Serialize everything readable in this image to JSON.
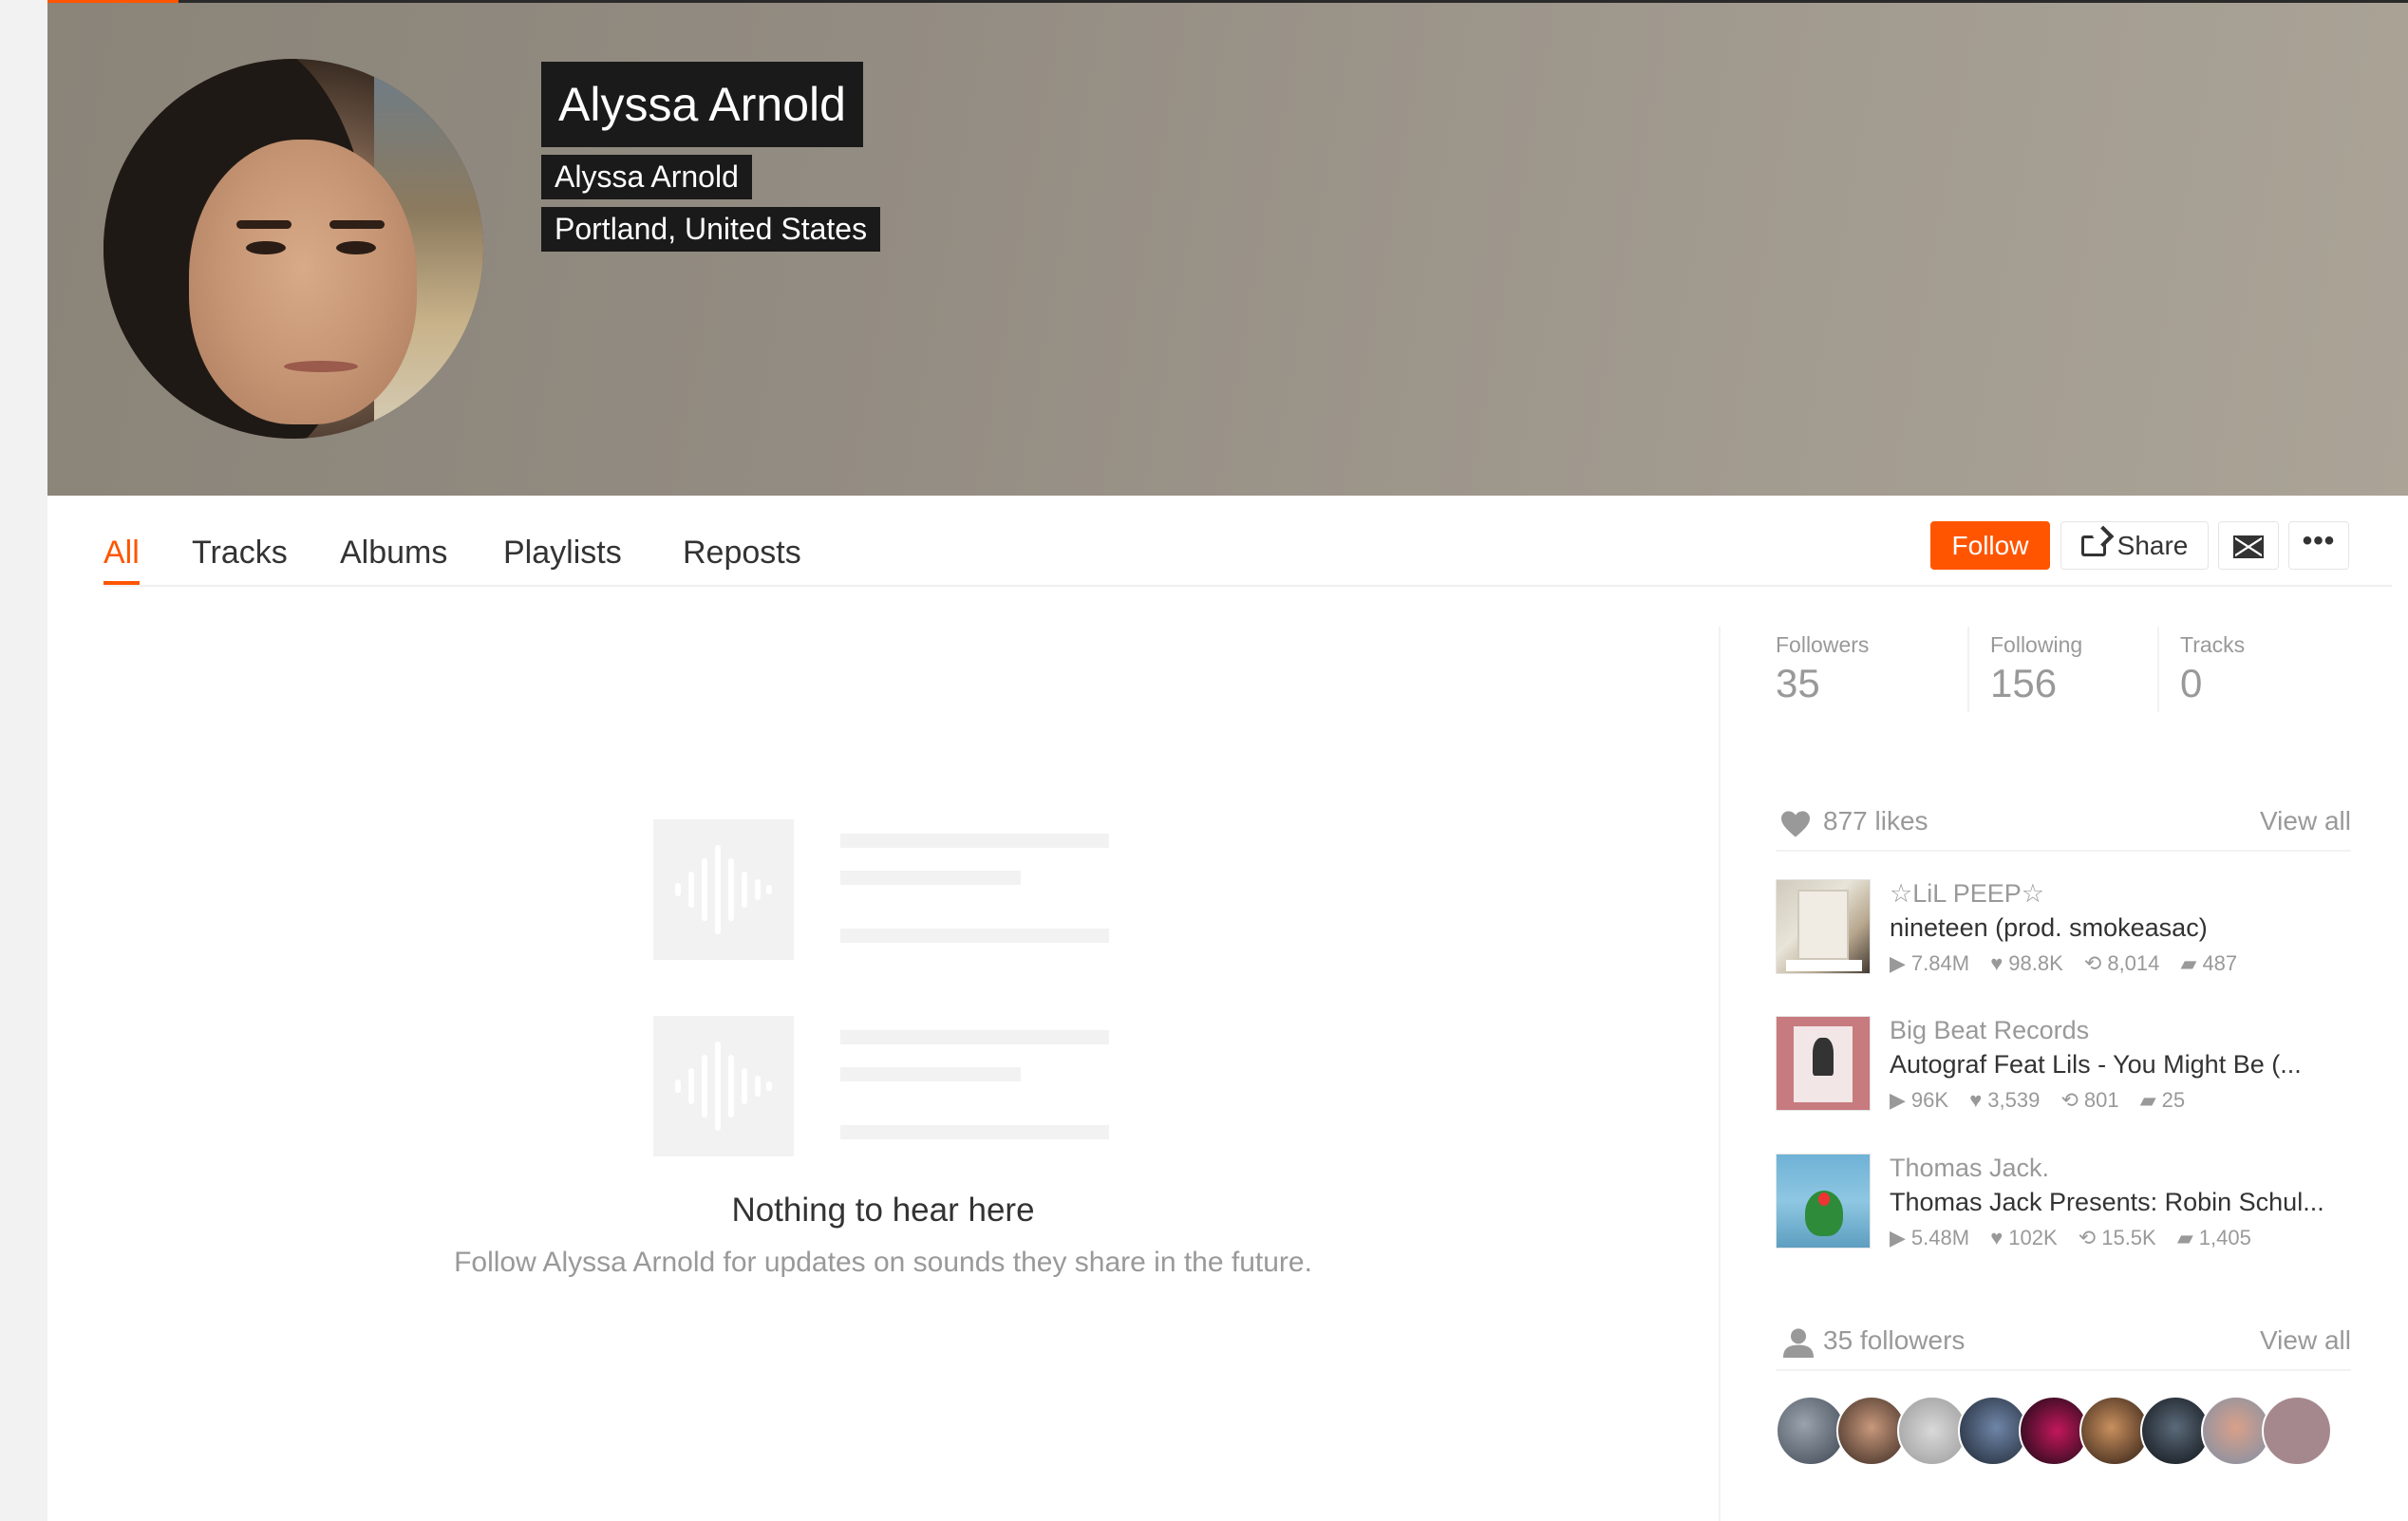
{
  "profile": {
    "display_name": "Alyssa Arnold",
    "username": "Alyssa Arnold",
    "location": "Portland, United States"
  },
  "tabs": [
    {
      "label": "All",
      "active": true
    },
    {
      "label": "Tracks"
    },
    {
      "label": "Albums"
    },
    {
      "label": "Playlists"
    },
    {
      "label": "Reposts"
    }
  ],
  "actions": {
    "follow_label": "Follow",
    "share_label": "Share",
    "more_label": "•••"
  },
  "empty_state": {
    "title": "Nothing to hear here",
    "description": "Follow Alyssa Arnold for updates on sounds they share in the future."
  },
  "stats": {
    "followers_label": "Followers",
    "followers_value": "35",
    "following_label": "Following",
    "following_value": "156",
    "tracks_label": "Tracks",
    "tracks_value": "0"
  },
  "likes": {
    "title": "877 likes",
    "view_all": "View all",
    "tracks": [
      {
        "artist": "☆LiL PEEP☆",
        "title": "nineteen (prod. smokeasac)",
        "plays": "7.84M",
        "likes": "98.8K",
        "reposts": "8,014",
        "comments": "487"
      },
      {
        "artist": "Big Beat Records",
        "title": "Autograf Feat Lils - You Might Be (...",
        "plays": "96K",
        "likes": "3,539",
        "reposts": "801",
        "comments": "25"
      },
      {
        "artist": "Thomas Jack.",
        "title": "Thomas Jack Presents: Robin Schul...",
        "plays": "5.48M",
        "likes": "102K",
        "reposts": "15.5K",
        "comments": "1,405"
      }
    ]
  },
  "followers_section": {
    "title": "35 followers",
    "view_all": "View all"
  },
  "colors": {
    "accent": "#ff5500",
    "muted": "#999999",
    "text": "#333333"
  }
}
